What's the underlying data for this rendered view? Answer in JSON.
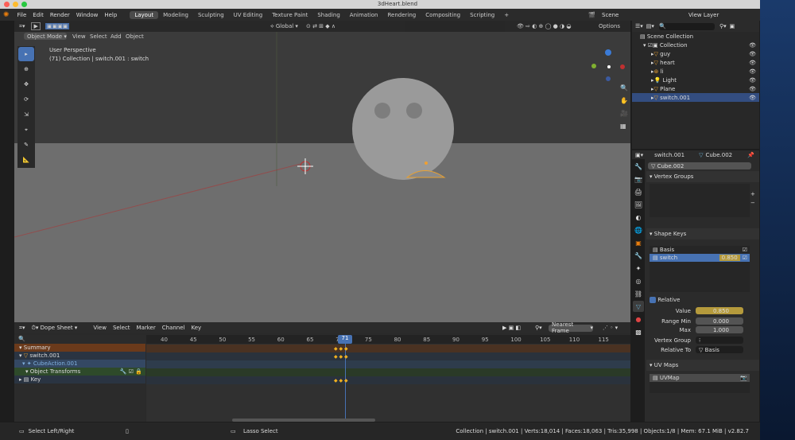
{
  "window": {
    "title": "3dHeart.blend"
  },
  "menu": [
    "File",
    "Edit",
    "Render",
    "Window",
    "Help"
  ],
  "workspaces": [
    "Layout",
    "Modeling",
    "Sculpting",
    "UV Editing",
    "Texture Paint",
    "Shading",
    "Animation",
    "Rendering",
    "Compositing",
    "Scripting"
  ],
  "scene": "Scene",
  "view_layer": "View Layer",
  "viewport": {
    "mode": "Object Mode",
    "menus": [
      "View",
      "Select",
      "Add",
      "Object"
    ],
    "orientation": "Global",
    "options": "Options",
    "overlay1": "User Perspective",
    "overlay2": "(71) Collection | switch.001 : switch"
  },
  "outliner": {
    "scene_collection": "Scene Collection",
    "collection": "Collection",
    "items": [
      "guy",
      "heart",
      "li",
      "Light",
      "Plane",
      "switch.001"
    ]
  },
  "properties": {
    "object": "switch.001",
    "mesh": "Cube.002",
    "mesh_field": "Cube.002",
    "vertex_groups": "Vertex Groups",
    "shape_keys": "Shape Keys",
    "keys": [
      {
        "name": "Basis",
        "value": ""
      },
      {
        "name": "switch",
        "value": "0.850"
      }
    ],
    "relative": "Relative",
    "value_label": "Value",
    "value": "0.850",
    "range_min_label": "Range Min",
    "range_min": "0.000",
    "max_label": "Max",
    "max": "1.000",
    "vgroup_label": "Vertex Group",
    "relative_to_label": "Relative To",
    "relative_to": "Basis",
    "uv_maps": "UV Maps",
    "uvmap": "UVMap"
  },
  "dope": {
    "mode": "Dope Sheet",
    "menus": [
      "View",
      "Select",
      "Marker",
      "Channel",
      "Key"
    ],
    "snap": "Nearest Frame",
    "frames": [
      "40",
      "45",
      "50",
      "55",
      "60",
      "65",
      "70",
      "75",
      "80",
      "85",
      "90",
      "95",
      "100",
      "105",
      "110",
      "115"
    ],
    "current": "71",
    "channels": [
      "Summary",
      "switch.001",
      "CubeAction.001",
      "Object Transforms",
      "Key"
    ]
  },
  "status": {
    "left": "Select Left/Right",
    "mid": "Lasso Select",
    "right": "Collection | switch.001 | Verts:18,014 | Faces:18,063 | Tris:35,998 | Objects:1/8 | Mem: 67.1 MiB | v2.82.7"
  }
}
